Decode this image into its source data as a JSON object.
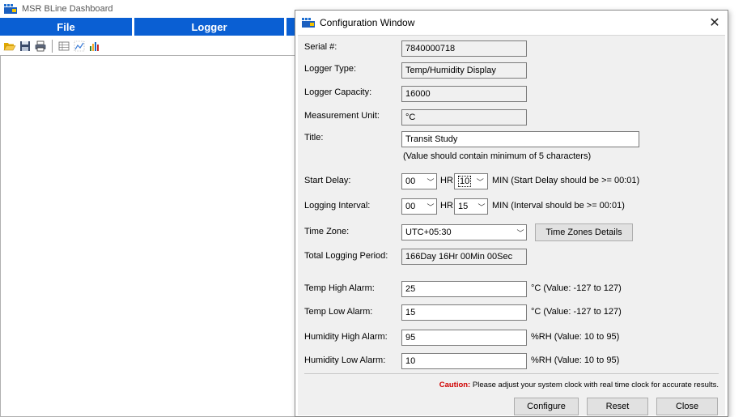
{
  "app": {
    "title": "MSR BLine Dashboard",
    "menu": {
      "file": "File",
      "logger": "Logger"
    }
  },
  "dialog": {
    "title": "Configuration Window",
    "close_glyph": "✕",
    "fields": {
      "serial_label": "Serial #:",
      "serial_value": "7840000718",
      "logger_type_label": "Logger Type:",
      "logger_type_value": "Temp/Humidity Display",
      "capacity_label": "Logger Capacity:",
      "capacity_value": "16000",
      "unit_label": "Measurement Unit:",
      "unit_value": "°C",
      "title_label": "Title:",
      "title_value": "Transit Study",
      "title_hint": "(Value should contain minimum of 5 characters)",
      "start_delay_label": "Start Delay:",
      "start_delay_hr": "00",
      "start_delay_min": "10",
      "start_delay_hint": "MIN (Start Delay should be >= 00:01)",
      "logging_interval_label": "Logging Interval:",
      "logging_interval_hr": "00",
      "logging_interval_min": "15",
      "logging_interval_hint": "MIN (Interval should be >= 00:01)",
      "hr_label": "HR",
      "timezone_label": "Time Zone:",
      "timezone_value": "UTC+05:30",
      "timezone_details_button": "Time Zones Details",
      "total_period_label": "Total Logging Period:",
      "total_period_value": "166Day 16Hr 00Min 00Sec",
      "temp_high_label": "Temp High Alarm:",
      "temp_high_value": "25",
      "temp_high_hint": "°C (Value: -127 to 127)",
      "temp_low_label": "Temp Low Alarm:",
      "temp_low_value": "15",
      "temp_low_hint": "°C (Value: -127 to 127)",
      "hum_high_label": "Humidity High Alarm:",
      "hum_high_value": "95",
      "hum_high_hint": "%RH (Value: 10 to 95)",
      "hum_low_label": "Humidity Low Alarm:",
      "hum_low_value": "10",
      "hum_low_hint": "%RH (Value: 10 to 95)"
    },
    "caution_label": "Caution:",
    "caution_text": "Please adjust your system clock with real time clock for accurate results.",
    "buttons": {
      "configure": "Configure",
      "reset": "Reset",
      "close": "Close"
    }
  },
  "colors": {
    "menu_bar": "#0a5fd3",
    "caution": "#d00000"
  }
}
